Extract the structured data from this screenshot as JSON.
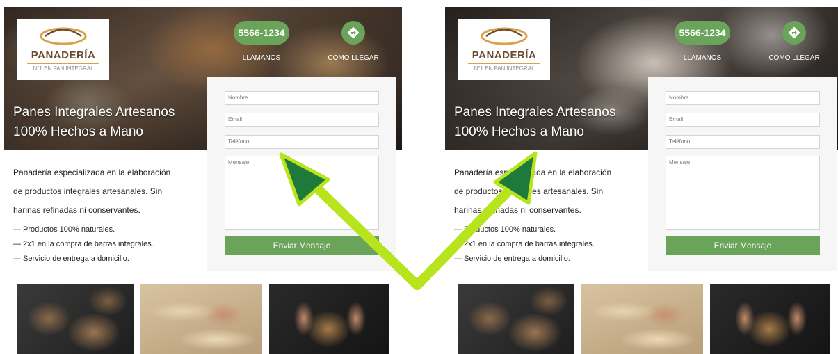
{
  "panels": [
    {
      "logo": {
        "name": "PANADERÍA",
        "tagline": "N°1 EN PAN INTEGRAL"
      },
      "phone": "5566-1234",
      "call_label": "LLÁMANOS",
      "directions_label": "CÓMO LLEGAR",
      "hero_title": [
        "Panes Integrales Artesanos",
        "100% Hechos a Mano"
      ],
      "description": [
        "Panadería especializada en la elaboración",
        "de productos integrales artesanales. Sin",
        "harinas refinadas ni conservantes."
      ],
      "features": [
        "— Productos 100% naturales.",
        "— 2x1 en la compra de barras integrales.",
        "— Servicio de entrega a domicilio."
      ],
      "form": {
        "name_placeholder": "Nombre",
        "email_placeholder": "Email",
        "phone_placeholder": "Teléfono",
        "message_placeholder": "Mensaje",
        "submit_label": "Enviar Mensaje"
      }
    },
    {
      "logo": {
        "name": "PANADERÍA",
        "tagline": "N°1 EN PAN INTEGRAL"
      },
      "phone": "5566-1234",
      "call_label": "LLÁMANOS",
      "directions_label": "CÓMO LLEGAR",
      "hero_title": [
        "Panes Integrales Artesanos",
        "100% Hechos a Mano"
      ],
      "description": [
        "Panadería especializada en la elaboración",
        "de productos integrales artesanales. Sin",
        "harinas refinadas ni conservantes."
      ],
      "features": [
        "— Productos 100% naturales.",
        "— 2x1 en la compra de barras integrales.",
        "— Servicio de entrega a domicilio."
      ],
      "form": {
        "name_placeholder": "Nombre",
        "email_placeholder": "Email",
        "phone_placeholder": "Teléfono",
        "message_placeholder": "Mensaje",
        "submit_label": "Enviar Mensaje"
      }
    }
  ],
  "colors": {
    "brand_green": "#6aa35a",
    "arrow_green": "#b8e41e",
    "arrow_dark": "#1e7a3a",
    "logo_brown": "#6b4a2e"
  },
  "icons": [
    "bread-logo-icon",
    "directions-icon",
    "arrow-annotation-icon"
  ]
}
